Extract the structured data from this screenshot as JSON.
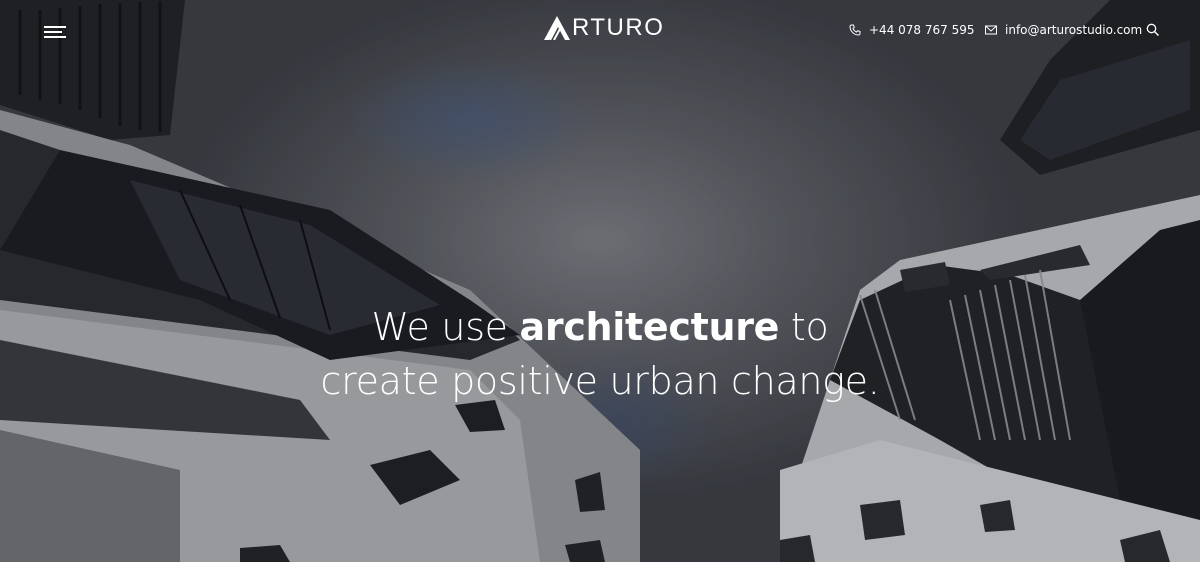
{
  "header": {
    "menu_icon": "hamburger-icon",
    "logo_text": "RTURO",
    "logo_mark": "triangle-a-icon",
    "phone": {
      "icon": "phone-icon",
      "text": "+44 078 767 595"
    },
    "email": {
      "icon": "envelope-icon",
      "text": "info@arturostudio.com"
    },
    "search_icon": "search-icon"
  },
  "hero": {
    "line1_pre": "We use",
    "line1_bold": "architecture",
    "line1_post": "to",
    "line2": "create positive urban change."
  },
  "colors": {
    "text": "#ffffff",
    "overlay": "#3b3e44"
  }
}
